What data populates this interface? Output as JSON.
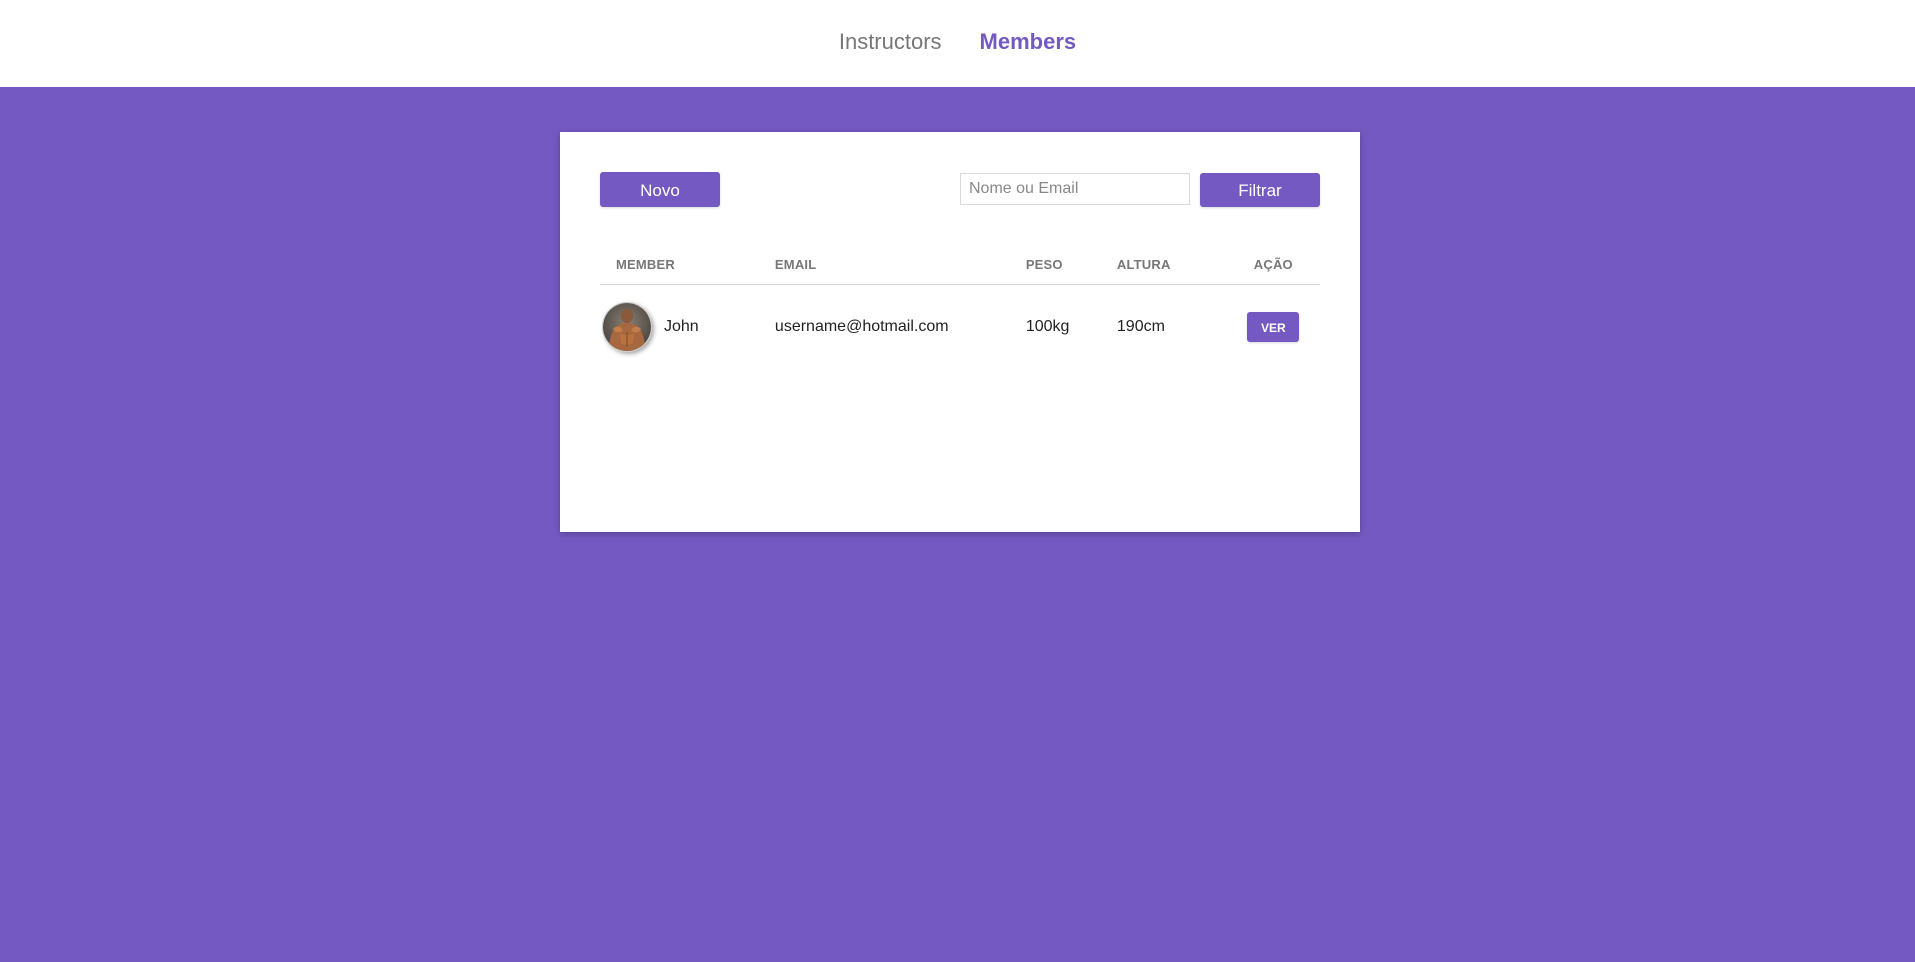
{
  "nav": {
    "items": [
      {
        "label": "Instructors",
        "active": false
      },
      {
        "label": "Members",
        "active": true
      }
    ]
  },
  "toolbar": {
    "new_label": "Novo",
    "search_placeholder": "Nome ou Email",
    "search_value": "",
    "filter_label": "Filtrar"
  },
  "table": {
    "headers": [
      "MEMBER",
      "EMAIL",
      "PESO",
      "ALTURA",
      "AÇÃO"
    ],
    "rows": [
      {
        "name": "John",
        "email": "username@hotmail.com",
        "peso": "100kg",
        "altura": "190cm",
        "action_label": "VER"
      }
    ]
  },
  "colors": {
    "accent": "#7459c2",
    "background": "#7459c2",
    "card": "#ffffff"
  }
}
